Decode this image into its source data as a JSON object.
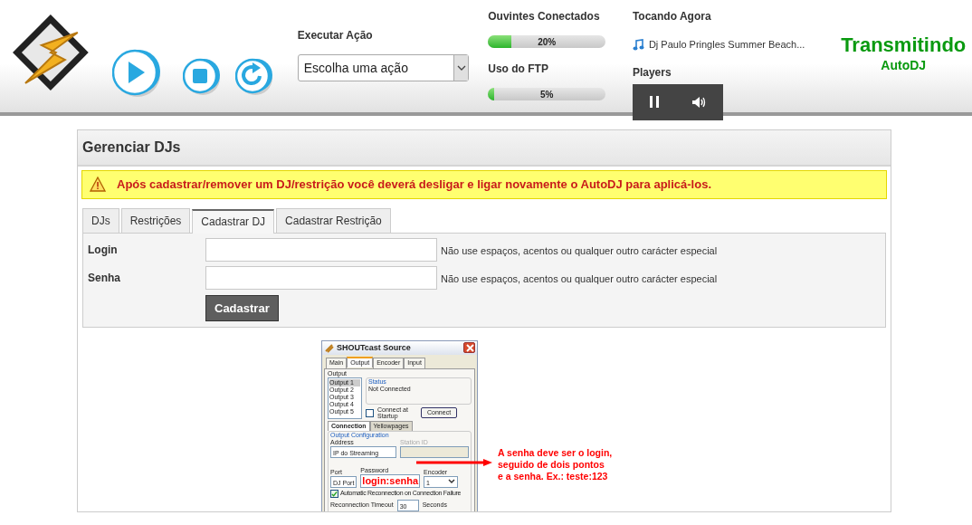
{
  "header": {
    "action": {
      "label": "Executar Ação",
      "value": "Escolha uma ação"
    },
    "meters": [
      {
        "label": "Ouvintes Conectados",
        "level": 0.2,
        "reading": "20%"
      },
      {
        "label": "Uso do FTP",
        "level": 0.05,
        "reading": "5%"
      }
    ],
    "now_playing": {
      "label": "Tocando Agora",
      "track": "Dj Paulo Pringles Summer Beach..."
    },
    "players": {
      "label": "Players"
    },
    "status": {
      "title": "Transmitindo",
      "subtitle": "AutoDJ"
    }
  },
  "panel": {
    "title": "Gerenciar DJs",
    "alert": "Após cadastrar/remover um DJ/restrição você deverá desligar e ligar novamente o AutoDJ para aplicá-los.",
    "tabs": [
      {
        "label": "DJs",
        "selected": false
      },
      {
        "label": "Restrições",
        "selected": false
      },
      {
        "label": "Cadastrar DJ",
        "selected": true
      },
      {
        "label": "Cadastrar Restrição",
        "selected": false
      }
    ],
    "fields": [
      {
        "label": "Login",
        "hint": "Não use espaços, acentos ou qualquer outro carácter especial"
      },
      {
        "label": "Senha",
        "hint": "Não use espaços, acentos ou qualquer outro carácter especial"
      }
    ],
    "submit": "Cadastrar"
  },
  "help_image": {
    "window_title": "SHOUTcast Source",
    "tabs": [
      {
        "label": "Main",
        "selected": false
      },
      {
        "label": "Output",
        "selected": true
      },
      {
        "label": "Encoder",
        "selected": false
      },
      {
        "label": "Input",
        "selected": false
      }
    ],
    "output_label": "Output",
    "outputs": [
      {
        "label": "Output 1",
        "selected": true
      },
      {
        "label": "Output 2",
        "selected": false
      },
      {
        "label": "Output 3",
        "selected": false
      },
      {
        "label": "Output 4",
        "selected": false
      },
      {
        "label": "Output 5",
        "selected": false
      }
    ],
    "status_label": "Status",
    "status_text": "Not Connected",
    "connect_startup": {
      "label": "Connect at Startup",
      "checked": false
    },
    "connect_button": "Connect",
    "subtabs": [
      {
        "label": "Connection",
        "selected": true
      },
      {
        "label": "Yellowpages",
        "selected": false
      }
    ],
    "config_label": "Output Configuration",
    "address_label": "Address",
    "address": "IP do Streaming",
    "station_label": "Station ID",
    "port_label": "Port",
    "port": "DJ Port",
    "password_label": "Password",
    "password": "login:senha",
    "encoder_label": "Encoder",
    "encoder": "1",
    "auto_reconnect": {
      "label": "Automatic Reconnection on Connection Failure",
      "checked": true
    },
    "timeout_label": "Reconnection Timeout",
    "timeout": "30",
    "seconds_label": "Seconds",
    "note": [
      "A senha deve ser o login,",
      "seguido de dois pontos",
      "e a senha. Ex.: teste:123"
    ]
  }
}
